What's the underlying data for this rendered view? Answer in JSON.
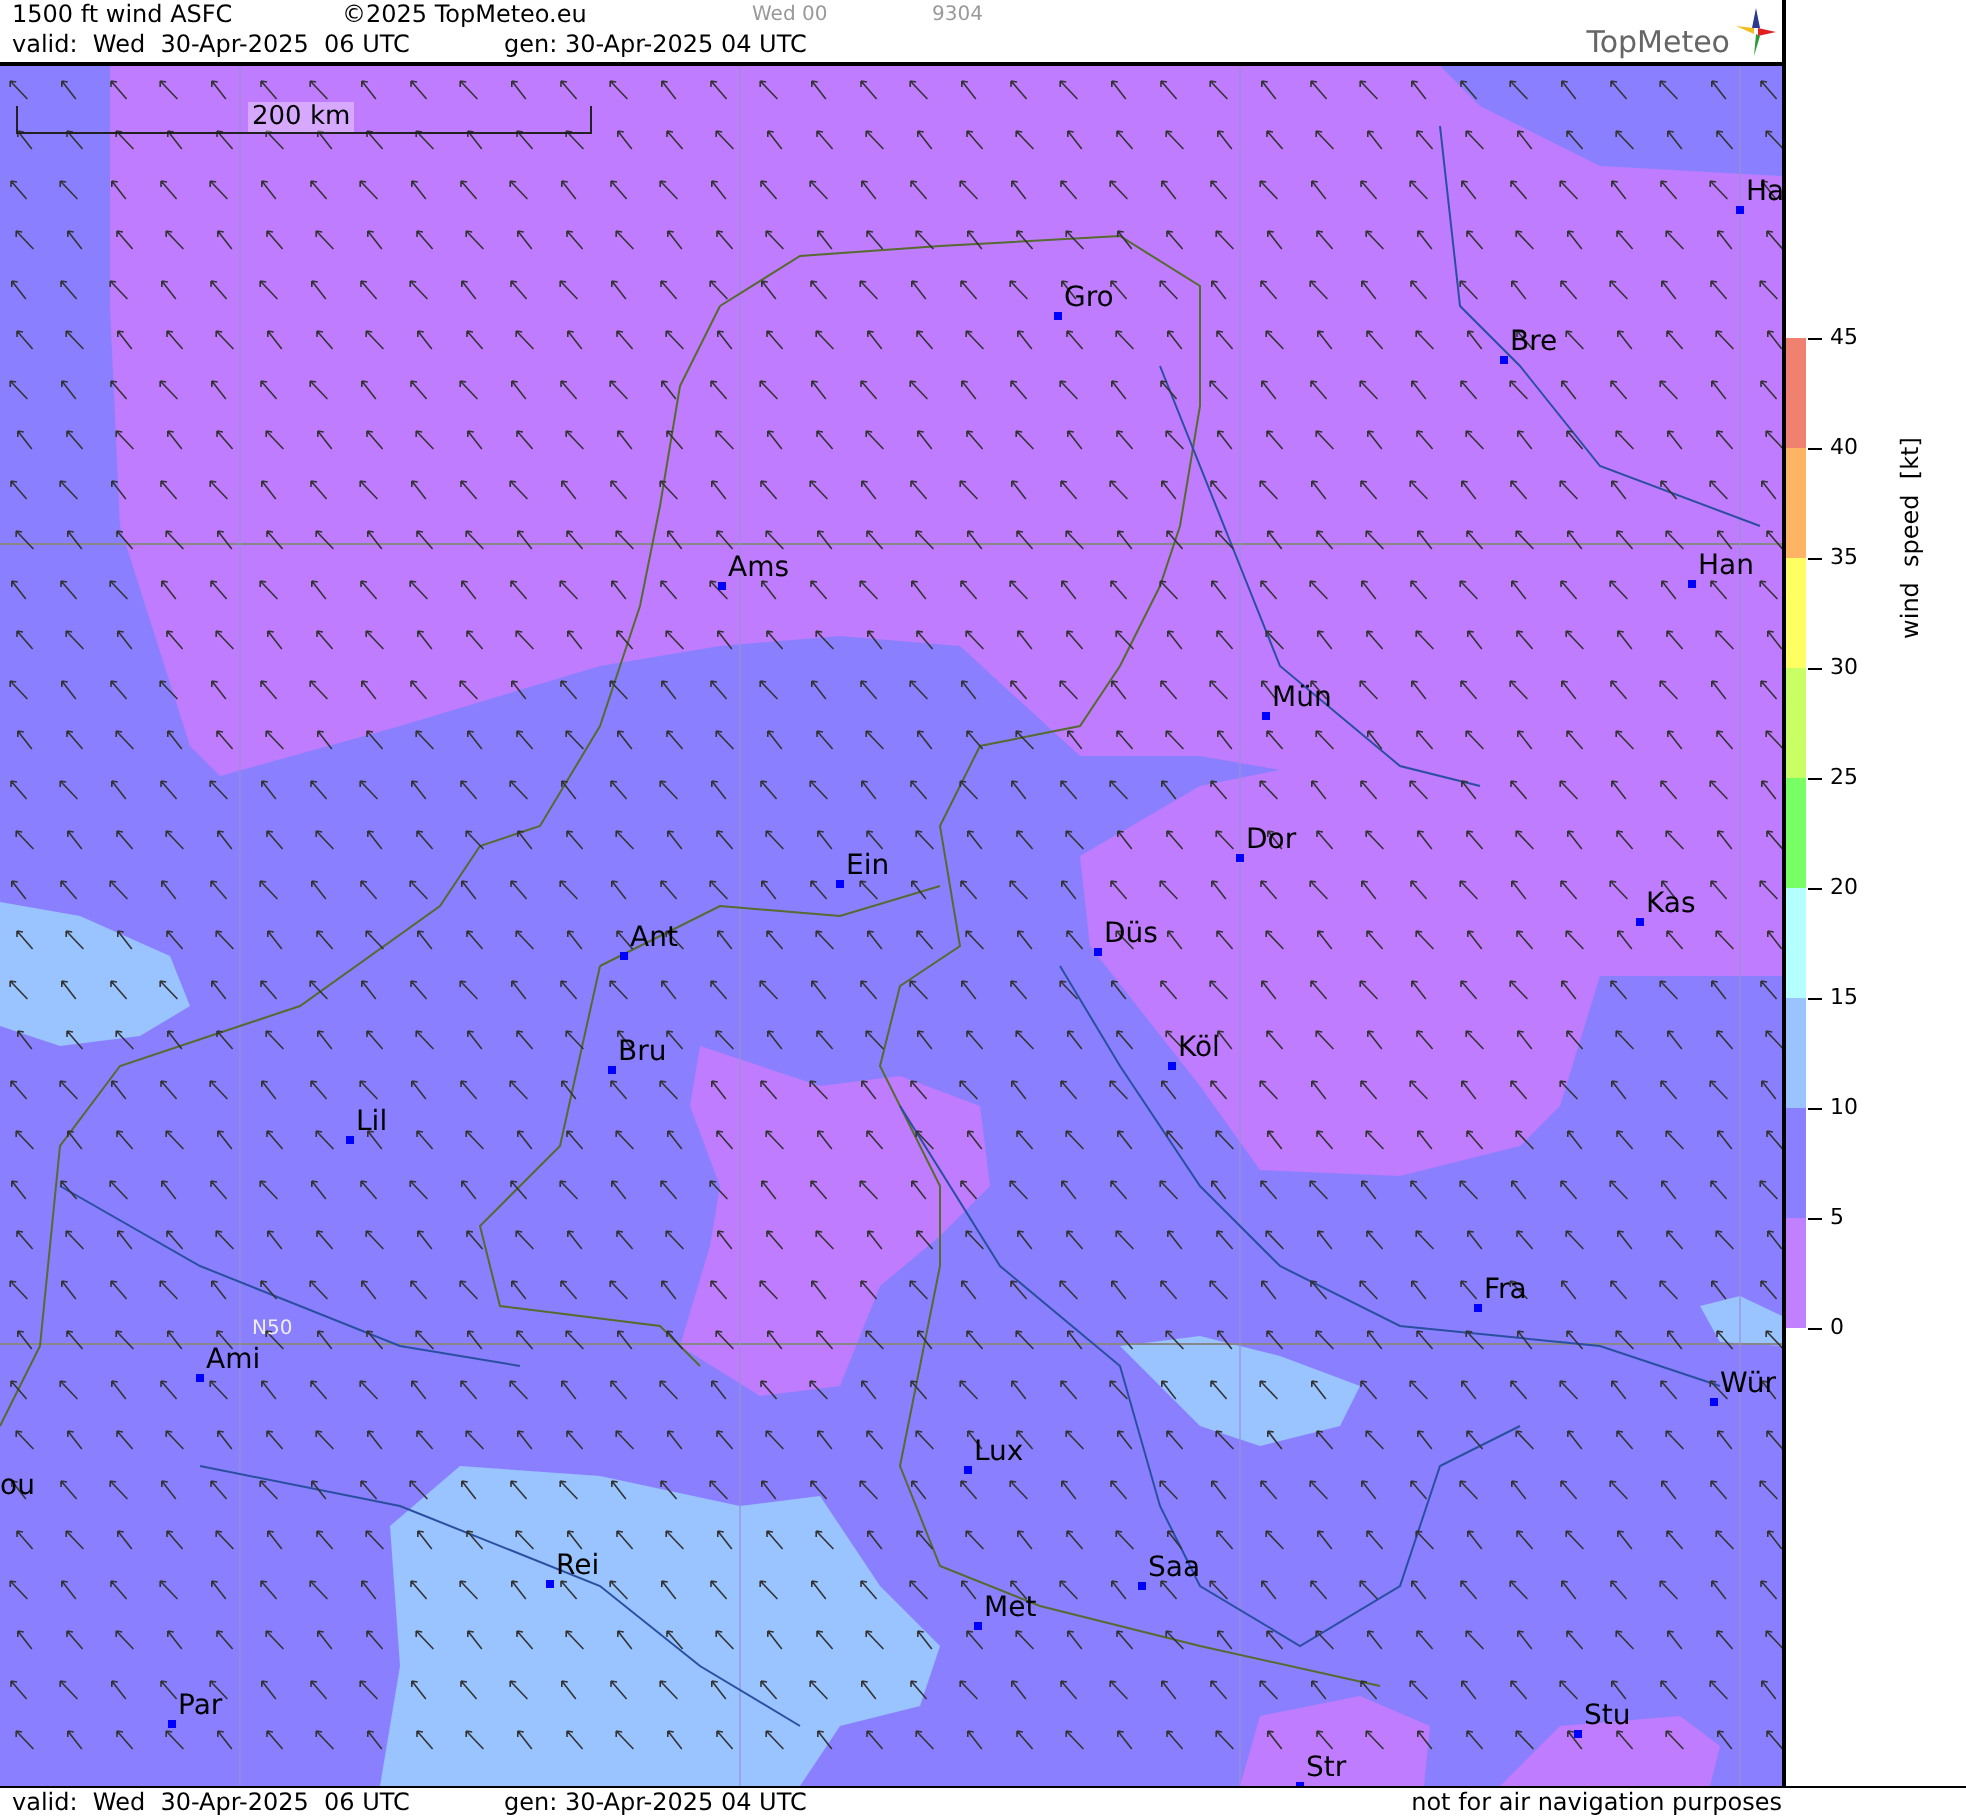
{
  "header": {
    "product": "1500 ft wind ASFC",
    "copyright": "©2025 TopMeteo.eu",
    "run": "Wed 00",
    "code": "9304",
    "valid": "valid:  Wed  30-Apr-2025  06 UTC",
    "generated": "gen: 30-Apr-2025 04 UTC",
    "logo": "TopMeteo"
  },
  "map": {
    "scale": "200 km",
    "grid_label": "N50",
    "cities": [
      {
        "name": "Ha"
      },
      {
        "name": "Gro"
      },
      {
        "name": "Bre"
      },
      {
        "name": "Ams"
      },
      {
        "name": "Han"
      },
      {
        "name": "Mün"
      },
      {
        "name": "Dor"
      },
      {
        "name": "Ein"
      },
      {
        "name": "Kas"
      },
      {
        "name": "Düs"
      },
      {
        "name": "Ant"
      },
      {
        "name": "Köl"
      },
      {
        "name": "Bru"
      },
      {
        "name": "Lil"
      },
      {
        "name": "Fra"
      },
      {
        "name": "Ami"
      },
      {
        "name": "Wür"
      },
      {
        "name": "Lux"
      },
      {
        "name": "ou"
      },
      {
        "name": "Rei"
      },
      {
        "name": "Saa"
      },
      {
        "name": "Met"
      },
      {
        "name": "Par"
      },
      {
        "name": "Stu"
      },
      {
        "name": "Str"
      }
    ]
  },
  "legend": {
    "title": "wind  speed  [kt]",
    "bands": [
      {
        "color": "#f08070"
      },
      {
        "color": "#ffb464"
      },
      {
        "color": "#ffff64"
      },
      {
        "color": "#c8ff64"
      },
      {
        "color": "#78ff64"
      },
      {
        "color": "#b4ffff"
      },
      {
        "color": "#99c4ff"
      },
      {
        "color": "#8a80ff"
      },
      {
        "color": "#c080ff"
      }
    ],
    "ticks": [
      "45",
      "40",
      "35",
      "30",
      "25",
      "20",
      "15",
      "10",
      "5",
      "0"
    ]
  },
  "footer": {
    "valid": "valid:  Wed  30-Apr-2025  06 UTC",
    "generated": "gen: 30-Apr-2025 04 UTC",
    "disclaimer": "not for air navigation purposes"
  }
}
